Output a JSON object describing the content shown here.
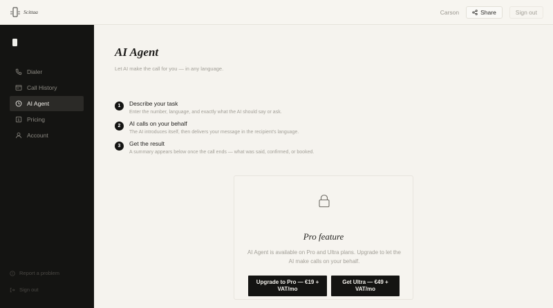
{
  "header": {
    "brand_name": "Scittaa",
    "user_name": "Carson",
    "share_label": "Share",
    "signout_label": "Sign out"
  },
  "sidebar": {
    "items": [
      {
        "label": "Dialer",
        "icon": "phone-icon"
      },
      {
        "label": "Call History",
        "icon": "call-history-icon"
      },
      {
        "label": "AI Agent",
        "icon": "clock-icon",
        "active": true
      },
      {
        "label": "Pricing",
        "icon": "pricing-icon"
      },
      {
        "label": "Account",
        "icon": "user-icon"
      }
    ],
    "report_label": "Report a problem",
    "signout_label": "Sign out"
  },
  "main": {
    "title": "AI Agent",
    "subtitle": "Let AI make the call for you — in any language.",
    "steps": [
      {
        "num": "1",
        "title": "Describe your task",
        "desc": "Enter the number, language, and exactly what the AI should say or ask."
      },
      {
        "num": "2",
        "title": "AI calls on your behalf",
        "desc": "The AI introduces itself, then delivers your message in the recipient's language."
      },
      {
        "num": "3",
        "title": "Get the result",
        "desc": "A summary appears below once the call ends — what was said, confirmed, or booked."
      }
    ],
    "pro_card": {
      "title": "Pro feature",
      "description": "AI Agent is available on Pro and Ultra plans. Upgrade to let the AI make calls on your behalf.",
      "upgrade_pro_label": "Upgrade to Pro — €19 + VAT/mo",
      "upgrade_ultra_label": "Get Ultra — €49 + VAT/mo"
    }
  },
  "colors": {
    "sidebar_bg": "#141412",
    "page_bg": "#f5f3ee",
    "accent": "#141412"
  }
}
